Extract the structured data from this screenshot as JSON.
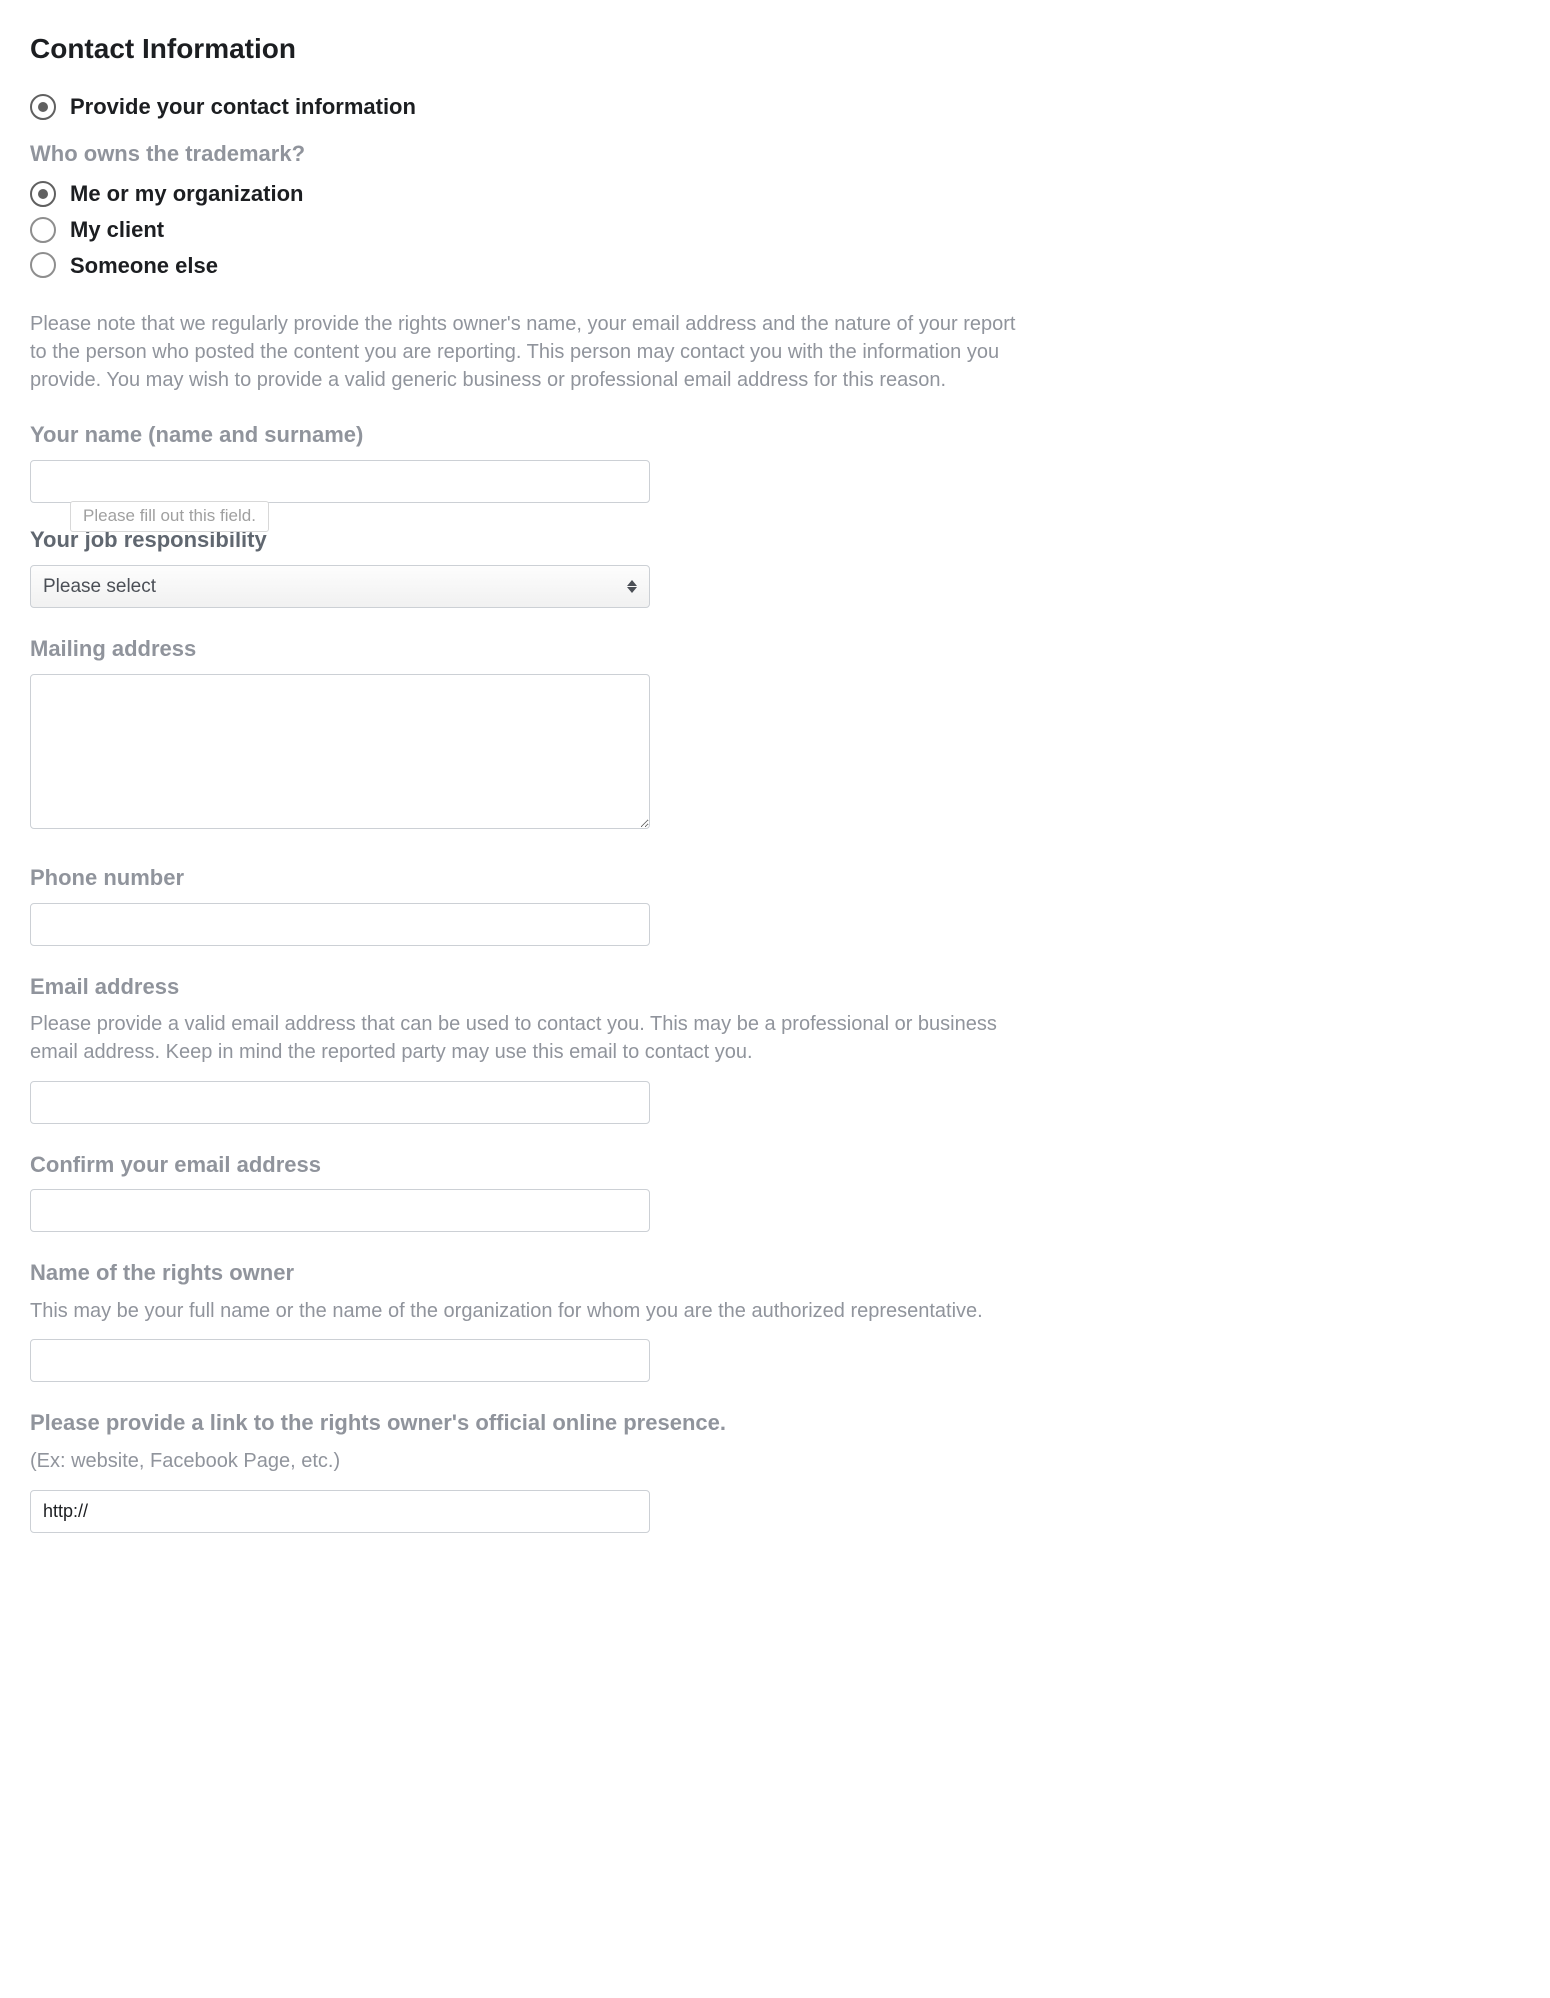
{
  "heading": "Contact Information",
  "provide_contact": {
    "label": "Provide your contact information",
    "checked": true
  },
  "owner_question": "Who owns the trademark?",
  "owner_options": [
    {
      "label": "Me or my organization",
      "checked": true
    },
    {
      "label": "My client",
      "checked": false
    },
    {
      "label": "Someone else",
      "checked": false
    }
  ],
  "notice_text": "Please note that we regularly provide the rights owner's name, your email address and the nature of your report to the person who posted the content you are reporting. This person may contact you with the information you provide. You may wish to provide a valid generic business or professional email address for this reason.",
  "name_field": {
    "label": "Your name (name and surname)",
    "tooltip": "Please fill out this field."
  },
  "job_field": {
    "label": "Your job responsibility",
    "select_placeholder": "Please select"
  },
  "mailing_field": {
    "label": "Mailing address"
  },
  "phone_field": {
    "label": "Phone number"
  },
  "email_field": {
    "label": "Email address",
    "helper": "Please provide a valid email address that can be used to contact you. This may be a professional or business email address. Keep in mind the reported party may use this email to contact you."
  },
  "confirm_email_field": {
    "label": "Confirm your email address"
  },
  "rights_owner_name_field": {
    "label": "Name of the rights owner",
    "helper": "This may be your full name or the name of the organization for whom you are the authorized representative."
  },
  "rights_owner_link_field": {
    "label": "Please provide a link to the rights owner's official online presence.",
    "helper": "(Ex: website, Facebook Page, etc.)",
    "value": "http://"
  }
}
